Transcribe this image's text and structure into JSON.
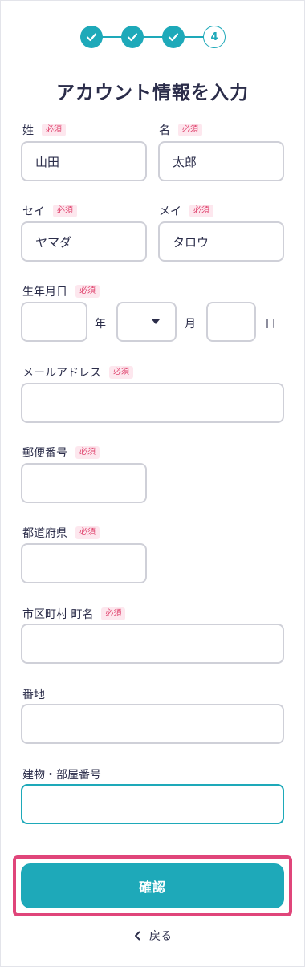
{
  "stepper": {
    "current_step": "4",
    "total_steps": 4
  },
  "page_title": "アカウント情報を入力",
  "required_badge": "必須",
  "fields": {
    "last_name": {
      "label": "姓",
      "value": "山田"
    },
    "first_name": {
      "label": "名",
      "value": "太郎"
    },
    "last_name_kana": {
      "label": "セイ",
      "value": "ヤマダ"
    },
    "first_name_kana": {
      "label": "メイ",
      "value": "タロウ"
    },
    "birthday": {
      "label": "生年月日",
      "year_unit": "年",
      "month_unit": "月",
      "day_unit": "日"
    },
    "email": {
      "label": "メールアドレス"
    },
    "postal_code": {
      "label": "郵便番号"
    },
    "prefecture": {
      "label": "都道府県"
    },
    "city": {
      "label": "市区町村 町名"
    },
    "address": {
      "label": "番地"
    },
    "building": {
      "label": "建物・部屋番号"
    }
  },
  "confirm_button": "確認",
  "back_link": "戻る",
  "colors": {
    "accent": "#1ea9b9",
    "required": "#e0456f",
    "highlight": "#e0457a",
    "text": "#2b2d4a"
  }
}
